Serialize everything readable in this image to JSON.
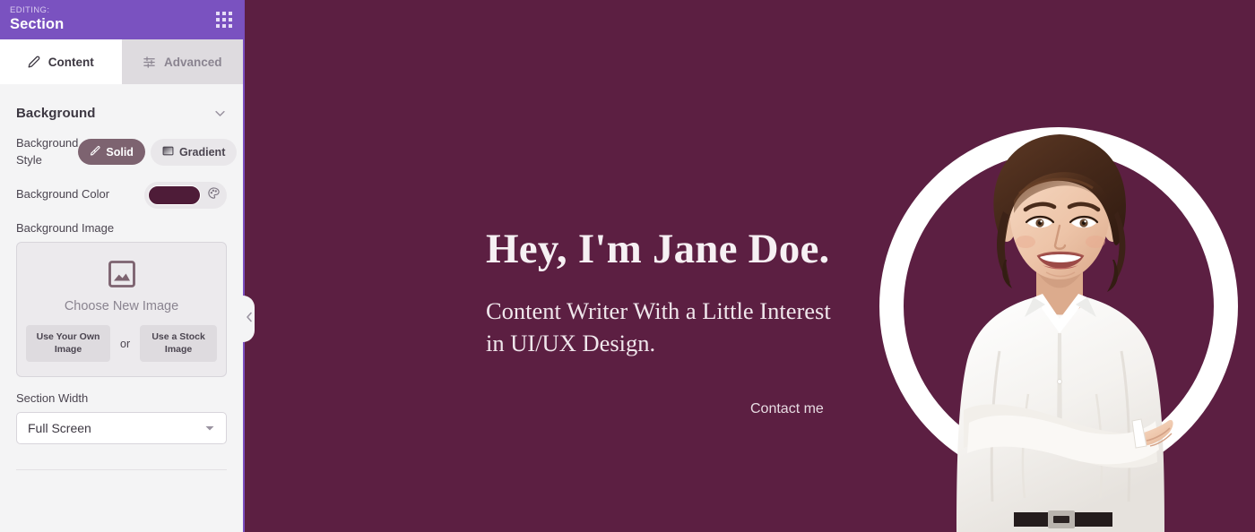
{
  "panel": {
    "header": {
      "editing_label": "EDITING:",
      "editing_target": "Section",
      "grid_icon": "grid-dots-icon"
    },
    "tabs": [
      {
        "label": "Content",
        "icon": "pencil-icon",
        "active": true
      },
      {
        "label": "Advanced",
        "icon": "sliders-icon",
        "active": false
      }
    ],
    "background_section": {
      "title": "Background",
      "collapse_icon": "chevron-down-icon",
      "background_style": {
        "label": "Background Style",
        "options": [
          {
            "label": "Solid",
            "icon": "eyedropper-icon",
            "selected": true
          },
          {
            "label": "Gradient",
            "icon": "gradient-swatch-icon",
            "selected": false
          }
        ]
      },
      "background_color": {
        "label": "Background Color",
        "value": "#4e1c38",
        "picker_icon": "palette-icon"
      },
      "background_image": {
        "label": "Background Image",
        "placeholder_icon": "image-placeholder-icon",
        "title": "Choose New Image",
        "own_image_button": "Use Your Own Image",
        "or_label": "or",
        "stock_image_button": "Use a Stock Image"
      },
      "section_width": {
        "label": "Section Width",
        "value": "Full Screen",
        "caret_icon": "caret-down-icon"
      }
    },
    "collapse_handle_icon": "chevron-left-icon"
  },
  "canvas": {
    "hero_title": "Hey, I'm Jane Doe.",
    "hero_subtitle_line1": "Content Writer With a Little Interest",
    "hero_subtitle_line2": "in UI/UX Design.",
    "contact_button": "Contact me",
    "portrait_alt": "portrait-photo"
  },
  "colors": {
    "panel_header_purple": "#7a52c0",
    "panel_background": "#f4f4f5",
    "canvas_background": "#5c1f42",
    "swatch_maroon": "#4e1c38",
    "accent_ring": "#ffffff"
  }
}
